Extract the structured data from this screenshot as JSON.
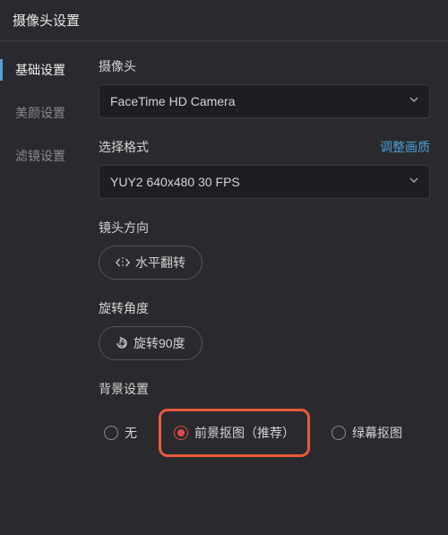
{
  "title": "摄像头设置",
  "sidebar": {
    "items": [
      {
        "label": "基础设置",
        "active": true
      },
      {
        "label": "美颜设置",
        "active": false
      },
      {
        "label": "滤镜设置",
        "active": false
      }
    ]
  },
  "main": {
    "camera": {
      "label": "摄像头",
      "value": "FaceTime HD Camera"
    },
    "format": {
      "label": "选择格式",
      "link": "调整画质",
      "value": "YUY2 640x480 30 FPS"
    },
    "direction": {
      "label": "镜头方向",
      "button": "水平翻转"
    },
    "rotation": {
      "label": "旋转角度",
      "button": "旋转90度"
    },
    "background": {
      "label": "背景设置",
      "options": [
        {
          "label": "无",
          "selected": false
        },
        {
          "label": "前景抠图（推荐）",
          "selected": true
        },
        {
          "label": "绿幕抠图",
          "selected": false
        }
      ]
    }
  }
}
